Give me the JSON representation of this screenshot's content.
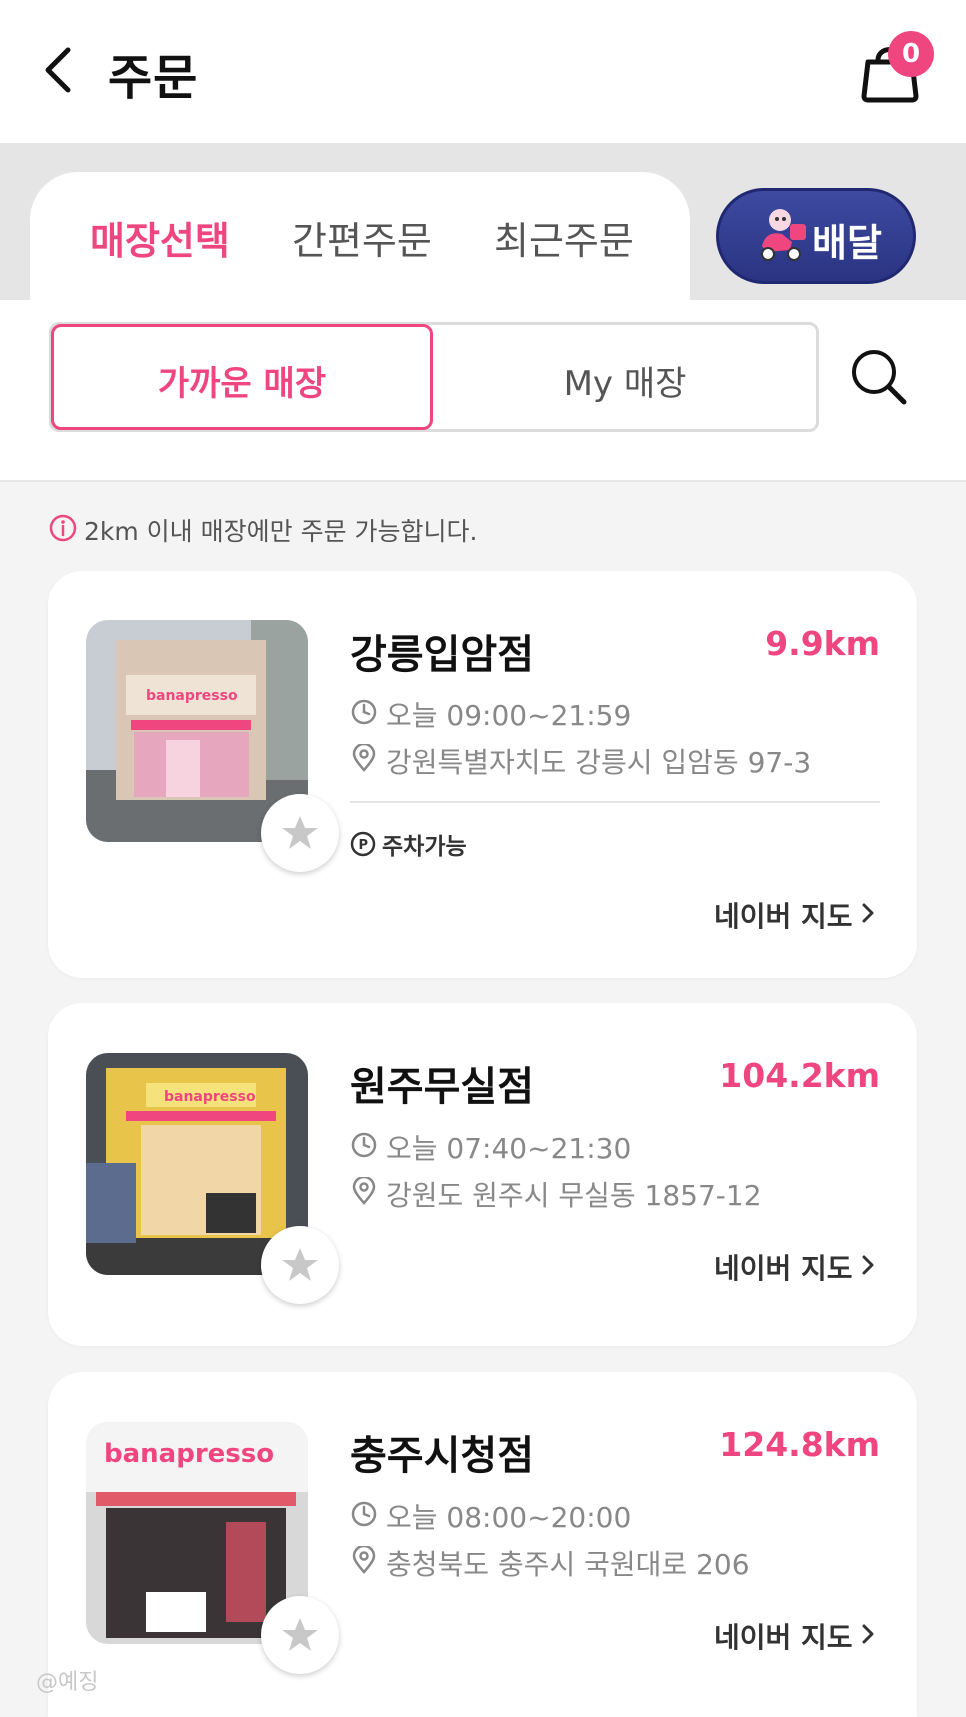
{
  "header": {
    "title": "주문",
    "cart_count": "0"
  },
  "tabs": [
    {
      "label": "매장선택",
      "active": true
    },
    {
      "label": "간편주문",
      "active": false
    },
    {
      "label": "최근주문",
      "active": false
    }
  ],
  "delivery_button": {
    "label": "배달"
  },
  "store_toggle": {
    "near_label": "가까운 매장",
    "my_label": "My 매장",
    "selected": "near"
  },
  "notice": "2km 이내 매장에만 주문 가능합니다.",
  "stores": [
    {
      "name": "강릉입암점",
      "distance": "9.9km",
      "hours": "오늘 09:00~21:59",
      "address": "강원특별자치도 강릉시 입암동 97-3",
      "tag": "주차가능",
      "map_link": "네이버 지도",
      "sign_text": "banapresso"
    },
    {
      "name": "원주무실점",
      "distance": "104.2km",
      "hours": "오늘 07:40~21:30",
      "address": "강원도 원주시 무실동 1857-12",
      "map_link": "네이버 지도",
      "sign_text": "banapresso"
    },
    {
      "name": "충주시청점",
      "distance": "124.8km",
      "hours": "오늘 08:00~20:00",
      "address": "충청북도 충주시 국원대로 206",
      "map_link": "네이버 지도",
      "sign_text": "banapresso"
    }
  ],
  "colors": {
    "accent": "#f0467f",
    "delivery_bg": "#2f3a8f",
    "page_bg": "#f4f4f4"
  },
  "watermark": "@예징"
}
